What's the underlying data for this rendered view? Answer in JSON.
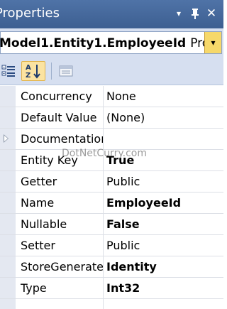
{
  "window": {
    "title": "Properties",
    "buttons": {
      "dropdown": "▾",
      "pin": "ᛦ",
      "close": "✕"
    }
  },
  "selector": {
    "object_name": "Model1.Entity1.EmployeeId",
    "object_type": "Prop",
    "dropdown_arrow": "▾"
  },
  "toolbar": {
    "categorized_icon": "categorized-icon",
    "alphabetical_icon": "alphabetical-sort-icon",
    "property_pages_icon": "property-pages-icon",
    "alphabetical_selected": true
  },
  "properties": [
    {
      "name": "Concurrency",
      "value": "None",
      "bold": false,
      "expandable": false
    },
    {
      "name": "Default Value",
      "value": "(None)",
      "bold": false,
      "expandable": false
    },
    {
      "name": "Documentation",
      "value": "",
      "bold": false,
      "expandable": true
    },
    {
      "name": "Entity Key",
      "value": "True",
      "bold": true,
      "expandable": false
    },
    {
      "name": "Getter",
      "value": "Public",
      "bold": false,
      "expandable": false
    },
    {
      "name": "Name",
      "value": "EmployeeId",
      "bold": true,
      "expandable": false
    },
    {
      "name": "Nullable",
      "value": "False",
      "bold": true,
      "expandable": false
    },
    {
      "name": "Setter",
      "value": "Public",
      "bold": false,
      "expandable": false
    },
    {
      "name": "StoreGeneratedPattern",
      "value": "Identity",
      "bold": true,
      "expandable": false
    },
    {
      "name": "Type",
      "value": "Int32",
      "bold": true,
      "expandable": false
    }
  ],
  "watermark": "DotNetCurry.com"
}
